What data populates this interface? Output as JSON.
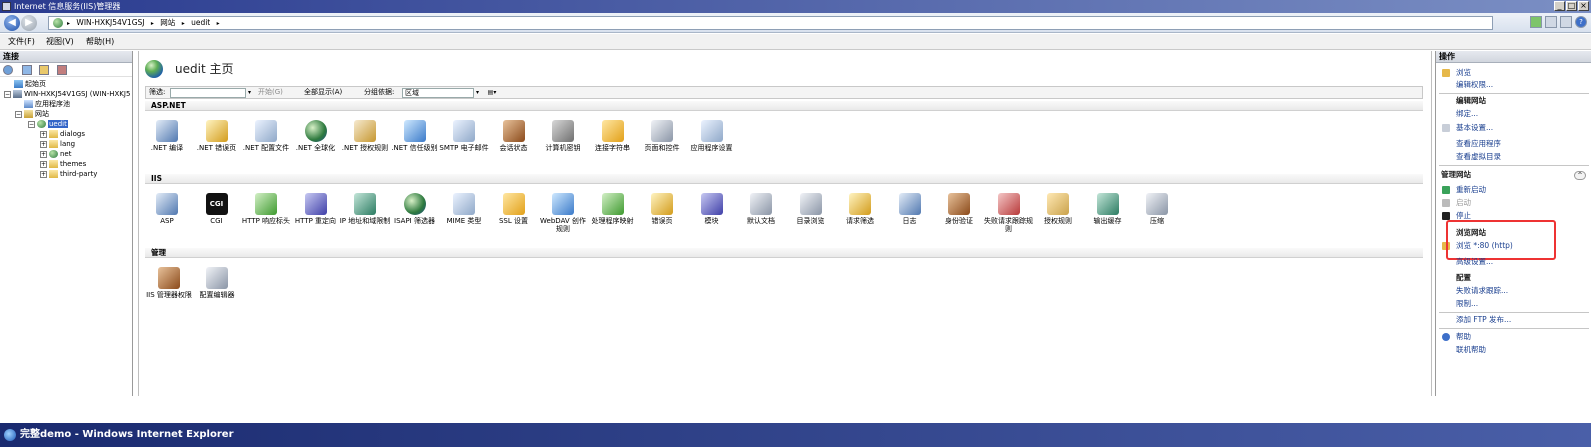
{
  "window": {
    "title": "Internet 信息服务(IIS)管理器",
    "controls": [
      "_",
      "□",
      "×"
    ]
  },
  "navbar": {
    "breadcrumbs": [
      "WIN-HXKJ54V1GSJ",
      "网站",
      "uedit"
    ],
    "separator": "▸"
  },
  "menu": {
    "items": [
      "文件(F)",
      "视图(V)",
      "帮助(H)"
    ]
  },
  "connections": {
    "title": "连接",
    "tree": [
      {
        "label": "起始页",
        "icon": "home-icon",
        "expander": ""
      },
      {
        "label": "WIN-HXKJ54V1GSJ (WIN-HXKJ5",
        "icon": "server-icon",
        "expander": "−"
      },
      {
        "label": "应用程序池",
        "icon": "app-pool-icon",
        "expander": ""
      },
      {
        "label": "网站",
        "icon": "sites-icon",
        "expander": "−"
      },
      {
        "label": "uedit",
        "icon": "globe-icon",
        "expander": "−"
      },
      {
        "label": "dialogs",
        "icon": "folder-icon",
        "expander": "+"
      },
      {
        "label": "lang",
        "icon": "folder-icon",
        "expander": "+"
      },
      {
        "label": "net",
        "icon": "globe-folder-icon",
        "expander": "+"
      },
      {
        "label": "themes",
        "icon": "folder-icon",
        "expander": "+"
      },
      {
        "label": "third-party",
        "icon": "folder-icon",
        "expander": "+"
      }
    ]
  },
  "main": {
    "title": "uedit 主页",
    "filter": {
      "label": "筛选:",
      "go_label": "开始(G)",
      "show_all_label": "全部显示(A)",
      "group_by_label": "分组依据:",
      "group_by_value": "区域"
    },
    "sections": [
      {
        "name": "ASP.NET",
        "features": [
          ".NET 编译",
          ".NET 错误页",
          ".NET 配置文件",
          ".NET 全球化",
          ".NET 授权规则",
          ".NET 信任级别",
          "SMTP 电子邮件",
          "会话状态",
          "计算机密钥",
          "连接字符串",
          "页面和控件",
          "应用程序设置"
        ]
      },
      {
        "name": "IIS",
        "features": [
          "ASP",
          "CGI",
          "HTTP 响应标头",
          "HTTP 重定向",
          "IP 地址和域限制",
          "ISAPI 筛选器",
          "MIME 类型",
          "SSL 设置",
          "WebDAV 创作规则",
          "处理程序映射",
          "错误页",
          "模块",
          "默认文档",
          "目录浏览",
          "请求筛选",
          "日志",
          "身份验证",
          "失败请求跟踪规则",
          "授权规则",
          "输出缓存",
          "压缩"
        ]
      },
      {
        "name": "管理",
        "features": [
          "IIS 管理器权限",
          "配置编辑器"
        ]
      }
    ]
  },
  "actions": {
    "title": "操作",
    "items": [
      {
        "label": "浏览",
        "kind": "link"
      },
      {
        "label": "编辑权限...",
        "kind": "link"
      },
      {
        "label": "编辑网站",
        "kind": "subheader"
      },
      {
        "label": "绑定...",
        "kind": "link"
      },
      {
        "label": "基本设置...",
        "kind": "link"
      },
      {
        "label": "查看应用程序",
        "kind": "link"
      },
      {
        "label": "查看虚拟目录",
        "kind": "link"
      },
      {
        "label": "管理网站",
        "kind": "subheader"
      },
      {
        "label": "重新启动",
        "kind": "link"
      },
      {
        "label": "启动",
        "kind": "disabled"
      },
      {
        "label": "停止",
        "kind": "link"
      },
      {
        "label": "浏览网站",
        "kind": "subheader"
      },
      {
        "label": "浏览 *:80 (http)",
        "kind": "link"
      },
      {
        "label": "高级设置...",
        "kind": "link"
      },
      {
        "label": "配置",
        "kind": "subheader"
      },
      {
        "label": "失败请求跟踪...",
        "kind": "link"
      },
      {
        "label": "限制...",
        "kind": "link"
      },
      {
        "label": "添加 FTP 发布...",
        "kind": "link"
      },
      {
        "label": "帮助",
        "kind": "link"
      },
      {
        "label": "联机帮助",
        "kind": "link"
      }
    ],
    "collapse_glyph": "^"
  },
  "taskbar": {
    "title": "完整demo - Windows Internet Explorer"
  },
  "colors": {
    "titlebar": "#2a3b8f",
    "selection": "#3365c8",
    "link": "#1a3f8f",
    "highlight_box": "#e33333"
  }
}
